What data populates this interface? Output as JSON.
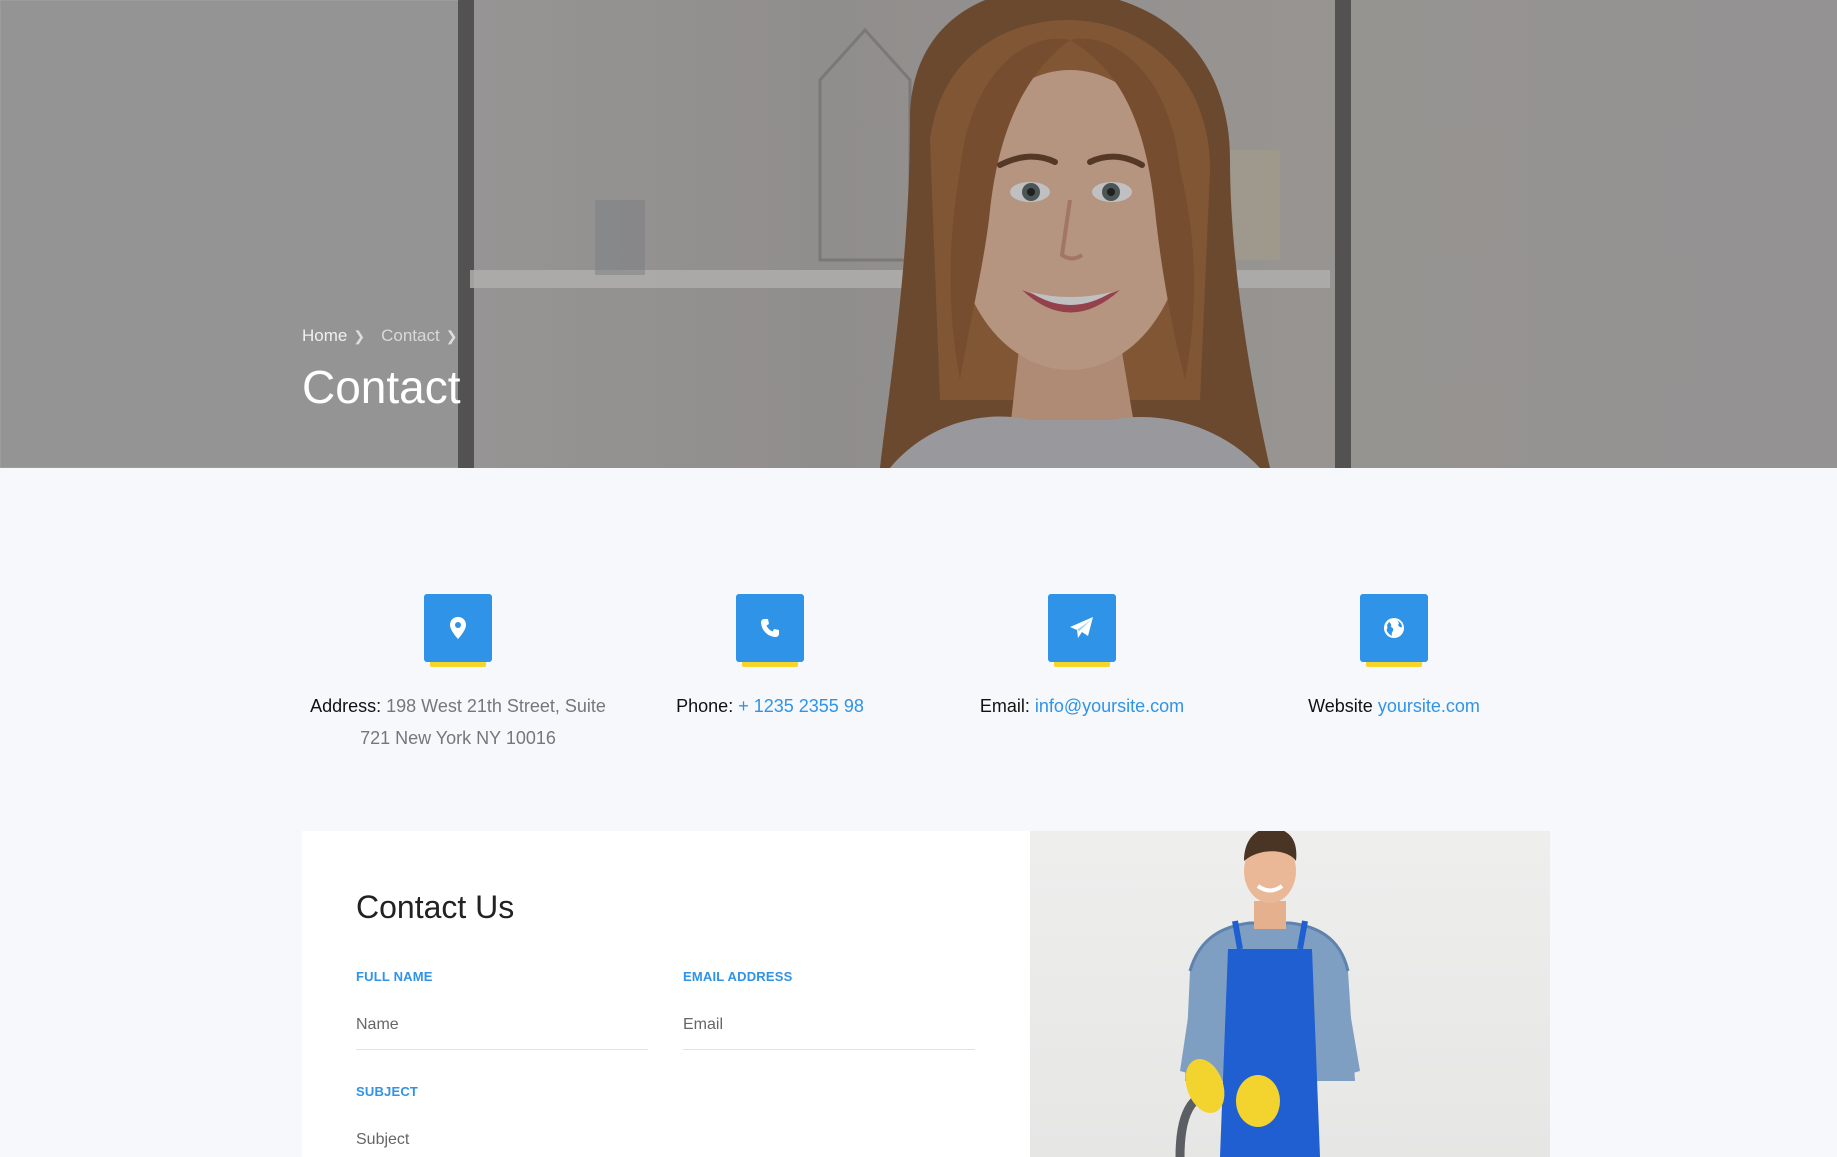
{
  "breadcrumb": {
    "items": [
      {
        "label": "Home"
      },
      {
        "label": "Contact"
      }
    ]
  },
  "hero": {
    "title": "Contact"
  },
  "contact_info": [
    {
      "icon": "map-pin-icon",
      "label": "Address:",
      "value": "198 West 21th Street, Suite 721 New York NY 10016",
      "is_link": false
    },
    {
      "icon": "phone-icon",
      "label": "Phone:",
      "value": "+ 1235 2355 98",
      "is_link": true
    },
    {
      "icon": "paper-plane-icon",
      "label": "Email:",
      "value": "info@yoursite.com",
      "is_link": true
    },
    {
      "icon": "globe-icon",
      "label": "Website",
      "value": "yoursite.com",
      "is_link": true
    }
  ],
  "form": {
    "title": "Contact Us",
    "fields": {
      "name": {
        "label": "FULL NAME",
        "placeholder": "Name"
      },
      "email": {
        "label": "EMAIL ADDRESS",
        "placeholder": "Email"
      },
      "subject": {
        "label": "SUBJECT",
        "placeholder": "Subject"
      }
    }
  },
  "colors": {
    "accent": "#2f93e8",
    "icon_underline": "#f5d52a",
    "page_bg": "#f7f8fc"
  }
}
